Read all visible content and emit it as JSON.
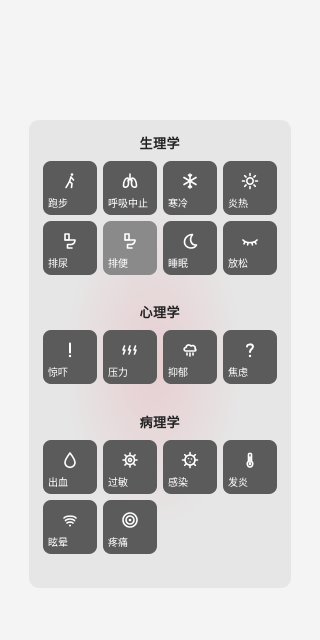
{
  "sections": [
    {
      "title": "生理学",
      "items": [
        {
          "label": "跑步",
          "icon": "running-icon"
        },
        {
          "label": "呼吸中止",
          "icon": "lungs-icon"
        },
        {
          "label": "寒冷",
          "icon": "snowflake-icon"
        },
        {
          "label": "炎热",
          "icon": "sun-icon"
        },
        {
          "label": "排尿",
          "icon": "toilet-icon"
        },
        {
          "label": "排便",
          "icon": "toilet-icon",
          "selected": true
        },
        {
          "label": "睡眠",
          "icon": "moon-icon"
        },
        {
          "label": "放松",
          "icon": "closed-eye-icon"
        }
      ]
    },
    {
      "title": "心理学",
      "items": [
        {
          "label": "惊吓",
          "icon": "exclamation-icon"
        },
        {
          "label": "压力",
          "icon": "lightning-icon"
        },
        {
          "label": "抑郁",
          "icon": "rain-cloud-icon"
        },
        {
          "label": "焦虑",
          "icon": "question-icon"
        }
      ]
    },
    {
      "title": "病理学",
      "items": [
        {
          "label": "出血",
          "icon": "blood-drop-icon"
        },
        {
          "label": "过敏",
          "icon": "pollen-icon"
        },
        {
          "label": "感染",
          "icon": "virus-icon"
        },
        {
          "label": "发炎",
          "icon": "thermometer-icon"
        },
        {
          "label": "眩晕",
          "icon": "dizzy-icon"
        },
        {
          "label": "疼痛",
          "icon": "pain-target-icon"
        }
      ]
    }
  ]
}
